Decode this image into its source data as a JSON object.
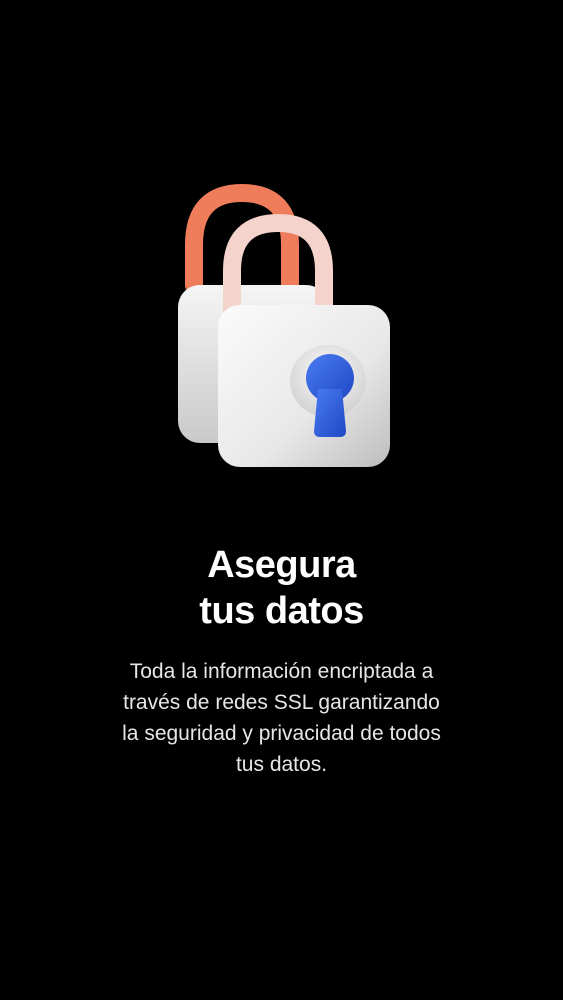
{
  "onboarding": {
    "illustration": {
      "icon": "padlock-keyhole-icon",
      "colors": {
        "back_shackle": "#ef7c5a",
        "front_shackle": "#f4d3cd",
        "lock_body": "#ececec",
        "keyhole": "#2f63e6"
      }
    },
    "title_lines": [
      "Asegura",
      "tus datos"
    ],
    "description_lines": [
      "Toda la información encriptada a",
      "través de redes SSL garantizando",
      "la seguridad y privacidad de todos",
      "tus datos."
    ]
  }
}
